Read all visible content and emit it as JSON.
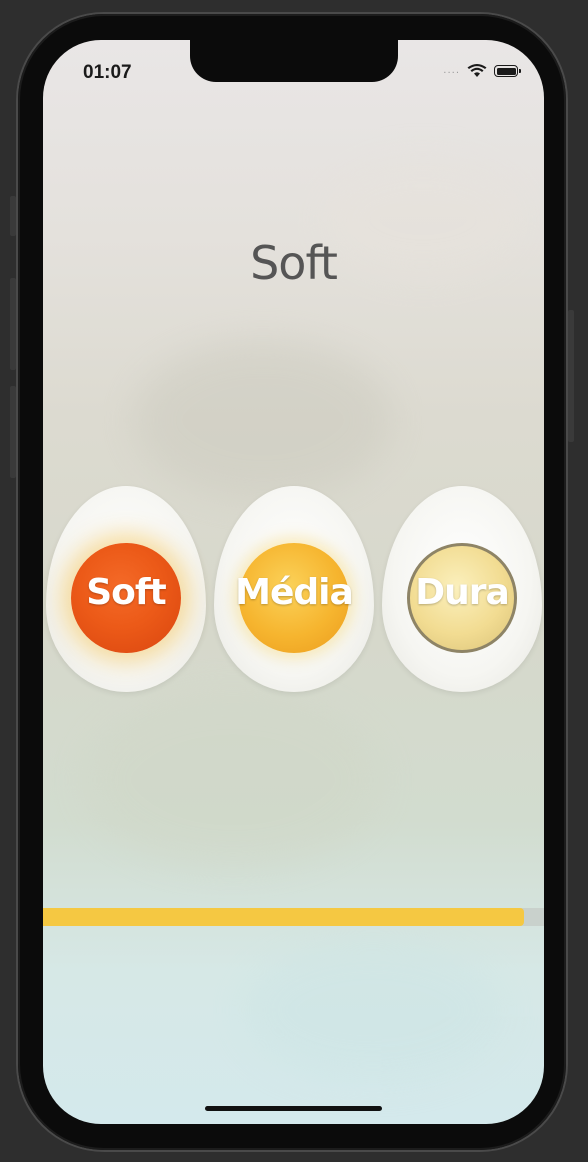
{
  "status_bar": {
    "time": "01:07",
    "signal": "....",
    "wifi_icon": "wifi-icon",
    "battery_icon": "battery-icon"
  },
  "title": "Soft",
  "eggs": [
    {
      "label": "Soft",
      "yolk_color": "#ec5a18"
    },
    {
      "label": "Média",
      "yolk_color": "#f6b52f"
    },
    {
      "label": "Dura",
      "yolk_color": "#f2dc92"
    }
  ],
  "progress": {
    "value": 0.96,
    "fill_color": "#f5c842",
    "track_color": "#c9d1cc"
  }
}
